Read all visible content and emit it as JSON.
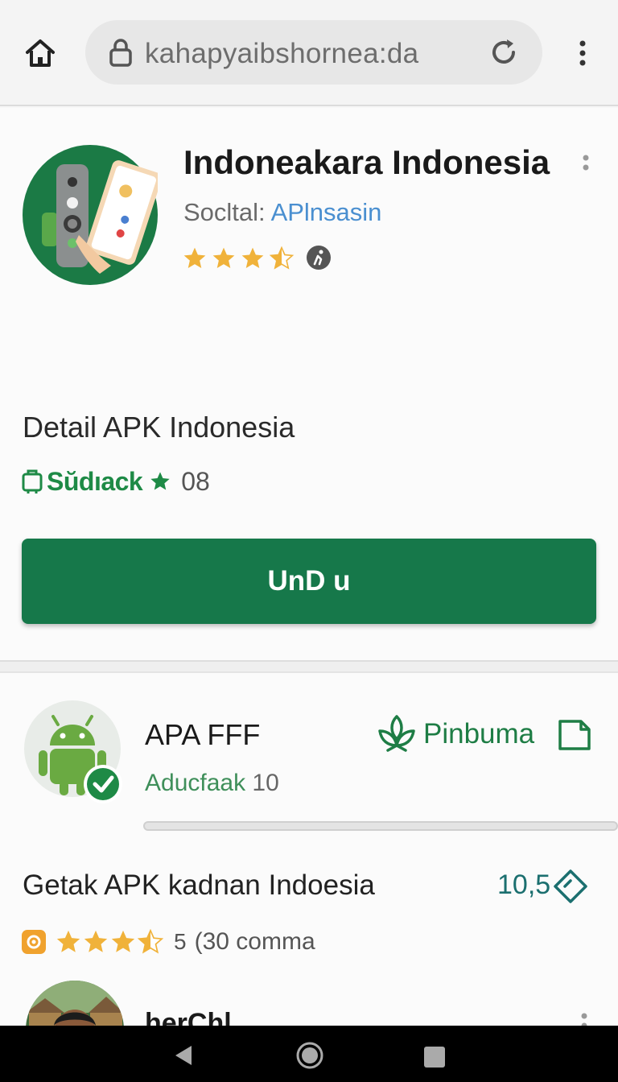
{
  "browser": {
    "url": "kahapyaibshornea:da"
  },
  "app": {
    "title": "Indoneakara Indonesia",
    "subtitle_label": "Socltal: ",
    "developer": "APlnsasin",
    "rating": 3.5
  },
  "detail": {
    "heading": "Detail APK Indonesia",
    "tag": "Sŭdıack",
    "number": "08"
  },
  "install_button": {
    "label": "UnD u"
  },
  "download_item": {
    "title": "APA FFF",
    "sub_label": "Aducfaak ",
    "sub_number": "10",
    "pin_label": "Pinbuma",
    "progress": 0.0
  },
  "listing": {
    "title": "Getak APK kadnan Indoesia",
    "size": "10,5",
    "rating": 3.5,
    "rating_num": "5",
    "rating_count": "(30 comma"
  },
  "reviewer": {
    "name": "herChl"
  },
  "colors": {
    "brand_green": "#16784a",
    "star": "#f0b23a",
    "link_blue": "#4a8fd0"
  }
}
